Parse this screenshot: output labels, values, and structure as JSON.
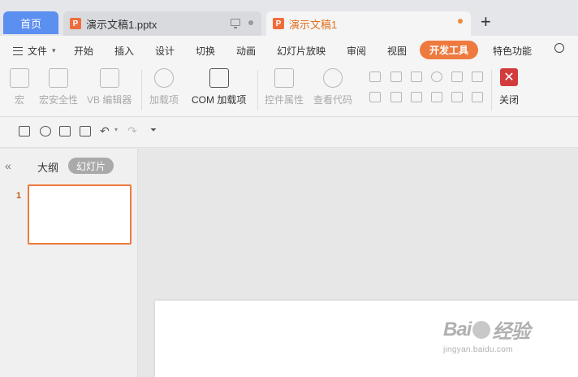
{
  "tabs": {
    "home": "首页",
    "doc1": "演示文稿1.pptx",
    "doc2": "演示文稿1",
    "new_tab": "+"
  },
  "menu": {
    "file": "文件",
    "items": [
      "开始",
      "插入",
      "设计",
      "切换",
      "动画",
      "幻灯片放映",
      "审阅",
      "视图",
      "开发工具",
      "特色功能"
    ],
    "active": "开发工具"
  },
  "ribbon": {
    "macro": "宏",
    "macro_security": "宏安全性",
    "vb_editor": "VB 编辑器",
    "addins": "加载项",
    "com_addins": "COM 加载项",
    "control_props": "控件属性",
    "view_code": "查看代码",
    "close": "关闭",
    "close_glyph": "✕"
  },
  "panel": {
    "outline": "大纲",
    "slides": "幻灯片",
    "collapse": "«",
    "slide_number": "1"
  },
  "watermark": {
    "logo_left": "Bai",
    "logo_right": "经验",
    "url": "jingyan.baidu.com"
  },
  "colors": {
    "accent": "#ee7a3f",
    "home_tab": "#5b8ff0",
    "close": "#d23c3c"
  }
}
